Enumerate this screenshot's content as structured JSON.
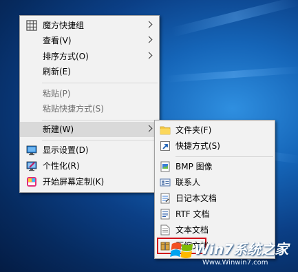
{
  "context_menu": {
    "items": [
      {
        "label": "魔方快捷组"
      },
      {
        "label": "查看(V)"
      },
      {
        "label": "排序方式(O)"
      },
      {
        "label": "刷新(E)"
      },
      {
        "label": "粘贴(P)"
      },
      {
        "label": "粘贴快捷方式(S)"
      },
      {
        "label": "新建(W)"
      },
      {
        "label": "显示设置(D)"
      },
      {
        "label": "个性化(R)"
      },
      {
        "label": "开始屏幕定制(K)"
      }
    ]
  },
  "new_submenu": {
    "items": [
      {
        "label": "文件夹(F)"
      },
      {
        "label": "快捷方式(S)"
      },
      {
        "label": "BMP 图像"
      },
      {
        "label": "联系人"
      },
      {
        "label": "日记本文档"
      },
      {
        "label": "RTF 文档"
      },
      {
        "label": "文本文档"
      },
      {
        "label": "压缩文档"
      }
    ]
  },
  "watermark": {
    "brand": "Win7系统之家",
    "url": "Www.Winwin7.com"
  },
  "colors": {
    "menu_bg": "#f2f2f2",
    "hover_bg": "#d9d9d9",
    "disabled_text": "#6d6d6d",
    "highlight_box": "#d0121b"
  }
}
